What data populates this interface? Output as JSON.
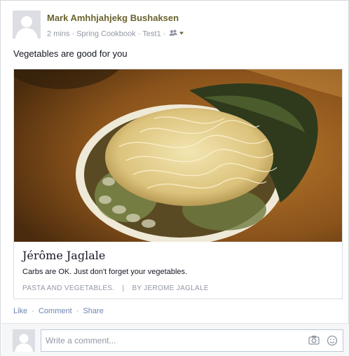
{
  "post": {
    "author": "Mark Amhhjahjekg Bushaksen",
    "time": "2 mins",
    "app": "Spring Cookbook",
    "location": "Test1",
    "separator": "·",
    "message": "Vegetables are good for you"
  },
  "attachment": {
    "title": "Jérôme Jaglale",
    "description": "Carbs are OK. Just don't forget your vegetables.",
    "source_left": "PASTA AND VEGETABLES.",
    "source_sep": "|",
    "source_right": "BY JEROME JAGLALE"
  },
  "actions": {
    "like": "Like",
    "comment": "Comment",
    "share": "Share",
    "dot": "·"
  },
  "comment_box": {
    "placeholder": "Write a comment..."
  },
  "icons": {
    "audience": "friends-icon",
    "audience_menu": "caret-down-icon",
    "camera": "camera-icon",
    "emoji": "smiley-icon"
  }
}
